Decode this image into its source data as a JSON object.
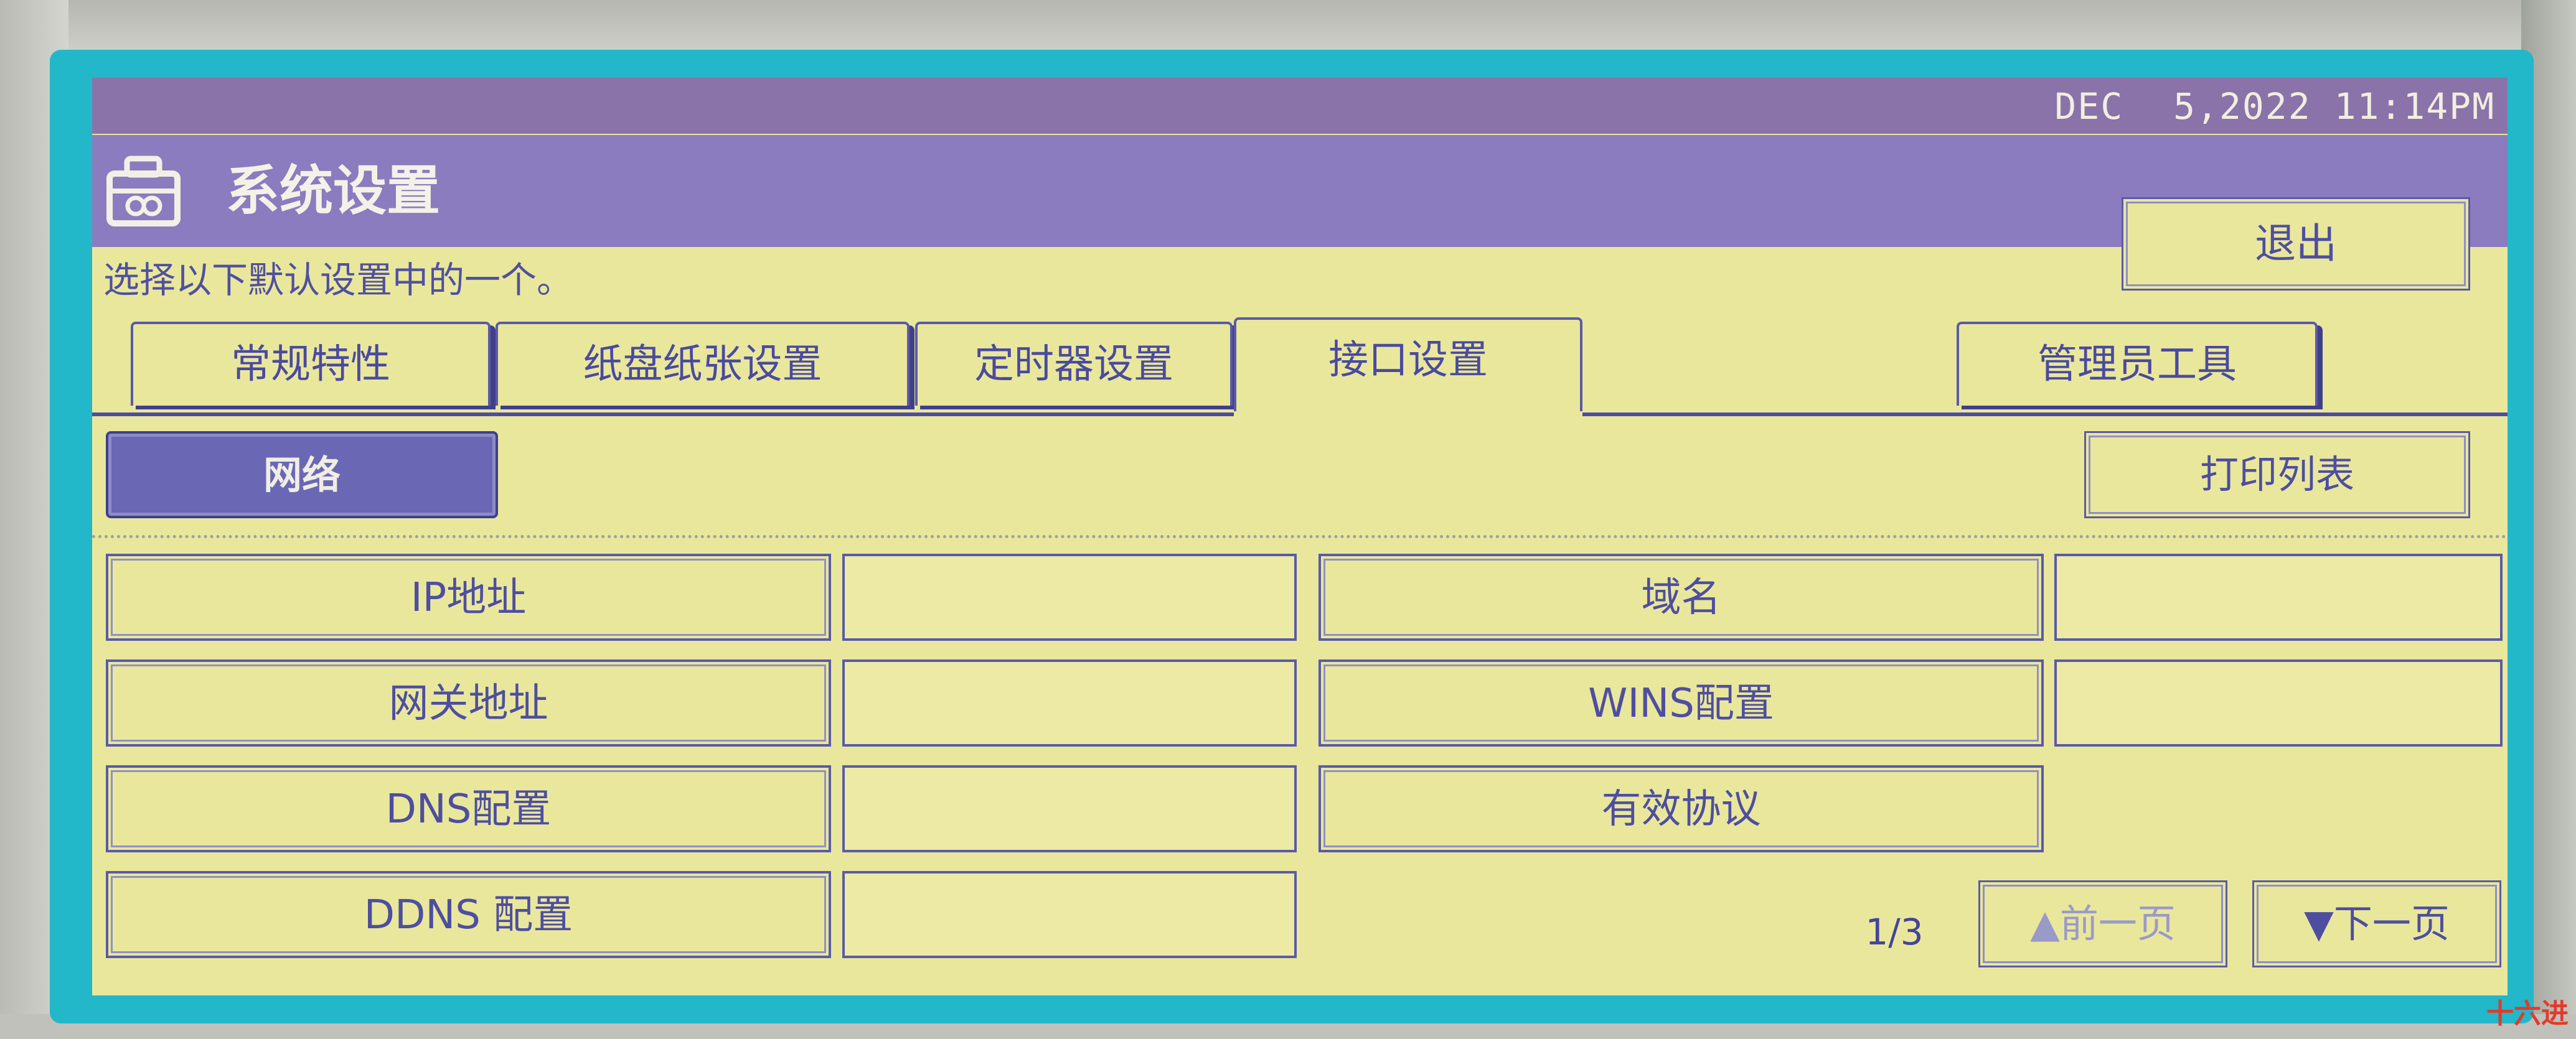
{
  "status_bar": {
    "date": "DEC",
    "date_num": "5,2022",
    "time": "11:14PM"
  },
  "header": {
    "title": "系统设置",
    "exit_label": "退出"
  },
  "instruction": "选择以下默认设置中的一个。",
  "tabs": [
    {
      "label": "常规特性"
    },
    {
      "label": "纸盘纸张设置"
    },
    {
      "label": "定时器设置"
    },
    {
      "label": "接口设置"
    },
    {
      "label": "管理员工具"
    }
  ],
  "active_tab": "接口设置",
  "subtoolbar": {
    "network_label": "网络",
    "print_list_label": "打印列表"
  },
  "settings_left": [
    {
      "label": "IP地址",
      "value": ""
    },
    {
      "label": "网关地址",
      "value": ""
    },
    {
      "label": "DNS配置",
      "value": ""
    },
    {
      "label": "DDNS 配置",
      "value": ""
    }
  ],
  "settings_right": [
    {
      "label": "域名",
      "value": ""
    },
    {
      "label": "WINS配置",
      "value": ""
    },
    {
      "label": "有效协议"
    }
  ],
  "pagination": {
    "page_text": "1/3",
    "prev_label": "▲前一页",
    "next_label": "▼下一页",
    "prev_enabled": false
  },
  "watermark": "十六进",
  "colors": {
    "screen_bg": "#e9e79c",
    "title_bar": "#8b7bbf",
    "status_bar": "#8a73a9",
    "frame": "#22b7c9",
    "accent_text": "#4e4ea0"
  }
}
